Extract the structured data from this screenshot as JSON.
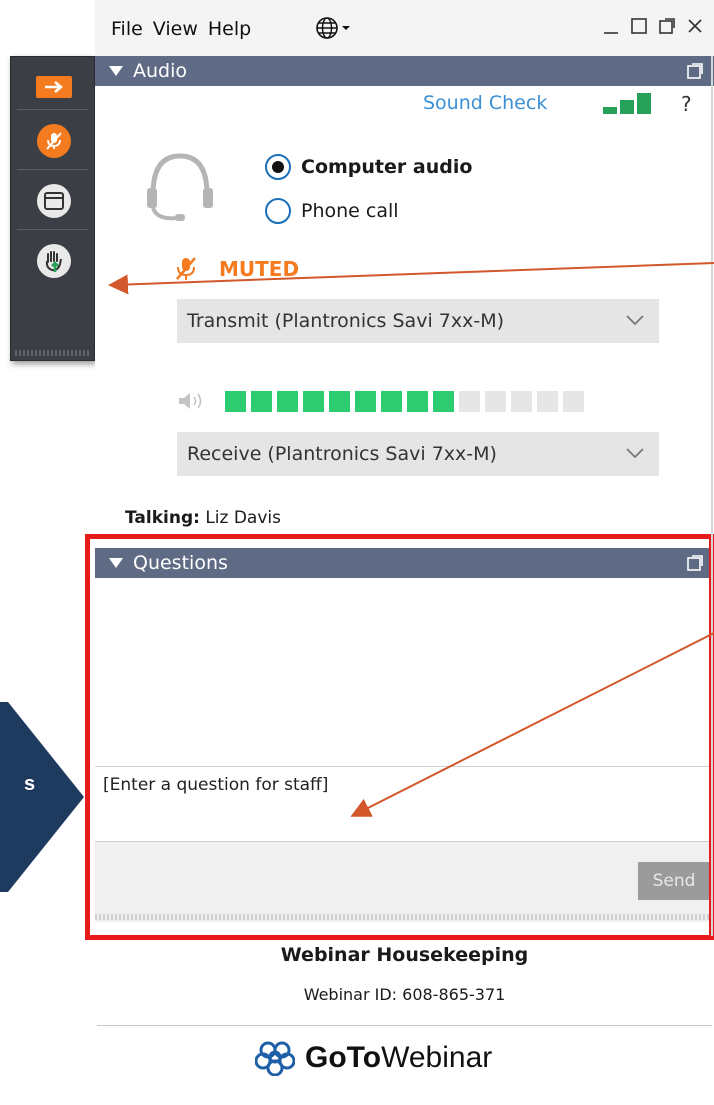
{
  "menu": {
    "file": "File",
    "view": "View",
    "help": "Help"
  },
  "audio": {
    "header": "Audio",
    "sound_check": "Sound Check",
    "help_mark": "?",
    "options": [
      {
        "label": "Computer audio",
        "selected": true
      },
      {
        "label": "Phone call",
        "selected": false
      }
    ],
    "muted_label": "MUTED",
    "transmit_device": "Transmit (Plantronics Savi 7xx-M)",
    "receive_device": "Receive (Plantronics Savi 7xx-M)",
    "input_level": {
      "active_bars": 9,
      "total_bars": 14
    }
  },
  "talking": {
    "label": "Talking:",
    "name": "Liz Davis"
  },
  "questions": {
    "header": "Questions",
    "input_placeholder": "[Enter a question for staff]",
    "send_label": "Send"
  },
  "footer": {
    "title": "Webinar Housekeeping",
    "webinar_id": "Webinar ID: 608-865-371",
    "brand_bold": "GoTo",
    "brand_rest": "Webinar"
  },
  "callout": {
    "partial_text": "s"
  },
  "colors": {
    "accent_orange": "#f47b20",
    "header_bg": "#5f6b84",
    "link_blue": "#3b8fd4",
    "level_green": "#2ecc71",
    "highlight_red": "#e81b1b",
    "callout_navy": "#1f3a5f"
  }
}
